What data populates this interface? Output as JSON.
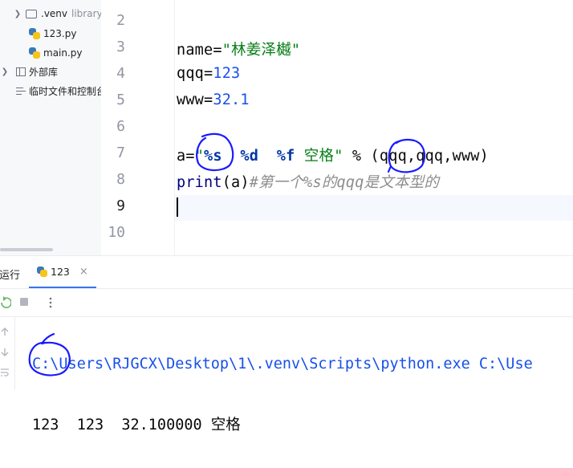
{
  "project_tree": {
    "items": [
      {
        "label": ".venv",
        "suffix": "library",
        "kind": "folder"
      },
      {
        "label": "123.py",
        "kind": "python-file"
      },
      {
        "label": "main.py",
        "kind": "python-file"
      },
      {
        "label": "外部库",
        "kind": "library"
      },
      {
        "label": "临时文件和控制台",
        "kind": "scratch"
      }
    ]
  },
  "editor": {
    "line_numbers": [
      "2",
      "3",
      "4",
      "5",
      "6",
      "7",
      "8",
      "9",
      "10"
    ],
    "current_line": "9",
    "lines": {
      "l3": {
        "name": "name",
        "eq": "=",
        "str": "\"林姜泽樾\""
      },
      "l4": {
        "name": "qqq",
        "eq": "=",
        "num": "123"
      },
      "l5": {
        "name": "www",
        "eq": "=",
        "num": "32.1"
      },
      "l7": {
        "pre": "a=",
        "q1": "\"",
        "f1": "%s",
        "sp1": "  ",
        "f2": "%d",
        "sp2": "  ",
        "f3": "%f",
        "rest": " 空格\"",
        "tail": " % (qqq,qqq,www)"
      },
      "l8": {
        "fn": "print",
        "args": "(a)",
        "comment": "#第一个%s的qqq是文本型的"
      }
    }
  },
  "run_panel": {
    "title": "运行",
    "tab_label": "123",
    "tab_close": "×",
    "console_path": "C:\\Users\\RJGCX\\Desktop\\1\\.venv\\Scripts\\python.exe C:\\Use",
    "console_output": "123  123  32.100000 空格"
  },
  "colors": {
    "string": "#067d17",
    "number": "#1750eb",
    "comment": "#8c8c8c",
    "annotation_ink": "#1a1aff"
  }
}
